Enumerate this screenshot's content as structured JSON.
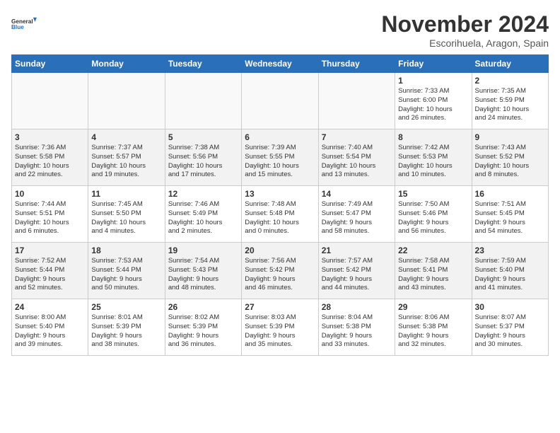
{
  "logo": {
    "line1": "General",
    "line2": "Blue"
  },
  "title": "November 2024",
  "location": "Escorihuela, Aragon, Spain",
  "weekdays": [
    "Sunday",
    "Monday",
    "Tuesday",
    "Wednesday",
    "Thursday",
    "Friday",
    "Saturday"
  ],
  "weeks": [
    [
      {
        "day": "",
        "info": ""
      },
      {
        "day": "",
        "info": ""
      },
      {
        "day": "",
        "info": ""
      },
      {
        "day": "",
        "info": ""
      },
      {
        "day": "",
        "info": ""
      },
      {
        "day": "1",
        "info": "Sunrise: 7:33 AM\nSunset: 6:00 PM\nDaylight: 10 hours\nand 26 minutes."
      },
      {
        "day": "2",
        "info": "Sunrise: 7:35 AM\nSunset: 5:59 PM\nDaylight: 10 hours\nand 24 minutes."
      }
    ],
    [
      {
        "day": "3",
        "info": "Sunrise: 7:36 AM\nSunset: 5:58 PM\nDaylight: 10 hours\nand 22 minutes."
      },
      {
        "day": "4",
        "info": "Sunrise: 7:37 AM\nSunset: 5:57 PM\nDaylight: 10 hours\nand 19 minutes."
      },
      {
        "day": "5",
        "info": "Sunrise: 7:38 AM\nSunset: 5:56 PM\nDaylight: 10 hours\nand 17 minutes."
      },
      {
        "day": "6",
        "info": "Sunrise: 7:39 AM\nSunset: 5:55 PM\nDaylight: 10 hours\nand 15 minutes."
      },
      {
        "day": "7",
        "info": "Sunrise: 7:40 AM\nSunset: 5:54 PM\nDaylight: 10 hours\nand 13 minutes."
      },
      {
        "day": "8",
        "info": "Sunrise: 7:42 AM\nSunset: 5:53 PM\nDaylight: 10 hours\nand 10 minutes."
      },
      {
        "day": "9",
        "info": "Sunrise: 7:43 AM\nSunset: 5:52 PM\nDaylight: 10 hours\nand 8 minutes."
      }
    ],
    [
      {
        "day": "10",
        "info": "Sunrise: 7:44 AM\nSunset: 5:51 PM\nDaylight: 10 hours\nand 6 minutes."
      },
      {
        "day": "11",
        "info": "Sunrise: 7:45 AM\nSunset: 5:50 PM\nDaylight: 10 hours\nand 4 minutes."
      },
      {
        "day": "12",
        "info": "Sunrise: 7:46 AM\nSunset: 5:49 PM\nDaylight: 10 hours\nand 2 minutes."
      },
      {
        "day": "13",
        "info": "Sunrise: 7:48 AM\nSunset: 5:48 PM\nDaylight: 10 hours\nand 0 minutes."
      },
      {
        "day": "14",
        "info": "Sunrise: 7:49 AM\nSunset: 5:47 PM\nDaylight: 9 hours\nand 58 minutes."
      },
      {
        "day": "15",
        "info": "Sunrise: 7:50 AM\nSunset: 5:46 PM\nDaylight: 9 hours\nand 56 minutes."
      },
      {
        "day": "16",
        "info": "Sunrise: 7:51 AM\nSunset: 5:45 PM\nDaylight: 9 hours\nand 54 minutes."
      }
    ],
    [
      {
        "day": "17",
        "info": "Sunrise: 7:52 AM\nSunset: 5:44 PM\nDaylight: 9 hours\nand 52 minutes."
      },
      {
        "day": "18",
        "info": "Sunrise: 7:53 AM\nSunset: 5:44 PM\nDaylight: 9 hours\nand 50 minutes."
      },
      {
        "day": "19",
        "info": "Sunrise: 7:54 AM\nSunset: 5:43 PM\nDaylight: 9 hours\nand 48 minutes."
      },
      {
        "day": "20",
        "info": "Sunrise: 7:56 AM\nSunset: 5:42 PM\nDaylight: 9 hours\nand 46 minutes."
      },
      {
        "day": "21",
        "info": "Sunrise: 7:57 AM\nSunset: 5:42 PM\nDaylight: 9 hours\nand 44 minutes."
      },
      {
        "day": "22",
        "info": "Sunrise: 7:58 AM\nSunset: 5:41 PM\nDaylight: 9 hours\nand 43 minutes."
      },
      {
        "day": "23",
        "info": "Sunrise: 7:59 AM\nSunset: 5:40 PM\nDaylight: 9 hours\nand 41 minutes."
      }
    ],
    [
      {
        "day": "24",
        "info": "Sunrise: 8:00 AM\nSunset: 5:40 PM\nDaylight: 9 hours\nand 39 minutes."
      },
      {
        "day": "25",
        "info": "Sunrise: 8:01 AM\nSunset: 5:39 PM\nDaylight: 9 hours\nand 38 minutes."
      },
      {
        "day": "26",
        "info": "Sunrise: 8:02 AM\nSunset: 5:39 PM\nDaylight: 9 hours\nand 36 minutes."
      },
      {
        "day": "27",
        "info": "Sunrise: 8:03 AM\nSunset: 5:39 PM\nDaylight: 9 hours\nand 35 minutes."
      },
      {
        "day": "28",
        "info": "Sunrise: 8:04 AM\nSunset: 5:38 PM\nDaylight: 9 hours\nand 33 minutes."
      },
      {
        "day": "29",
        "info": "Sunrise: 8:06 AM\nSunset: 5:38 PM\nDaylight: 9 hours\nand 32 minutes."
      },
      {
        "day": "30",
        "info": "Sunrise: 8:07 AM\nSunset: 5:37 PM\nDaylight: 9 hours\nand 30 minutes."
      }
    ]
  ]
}
